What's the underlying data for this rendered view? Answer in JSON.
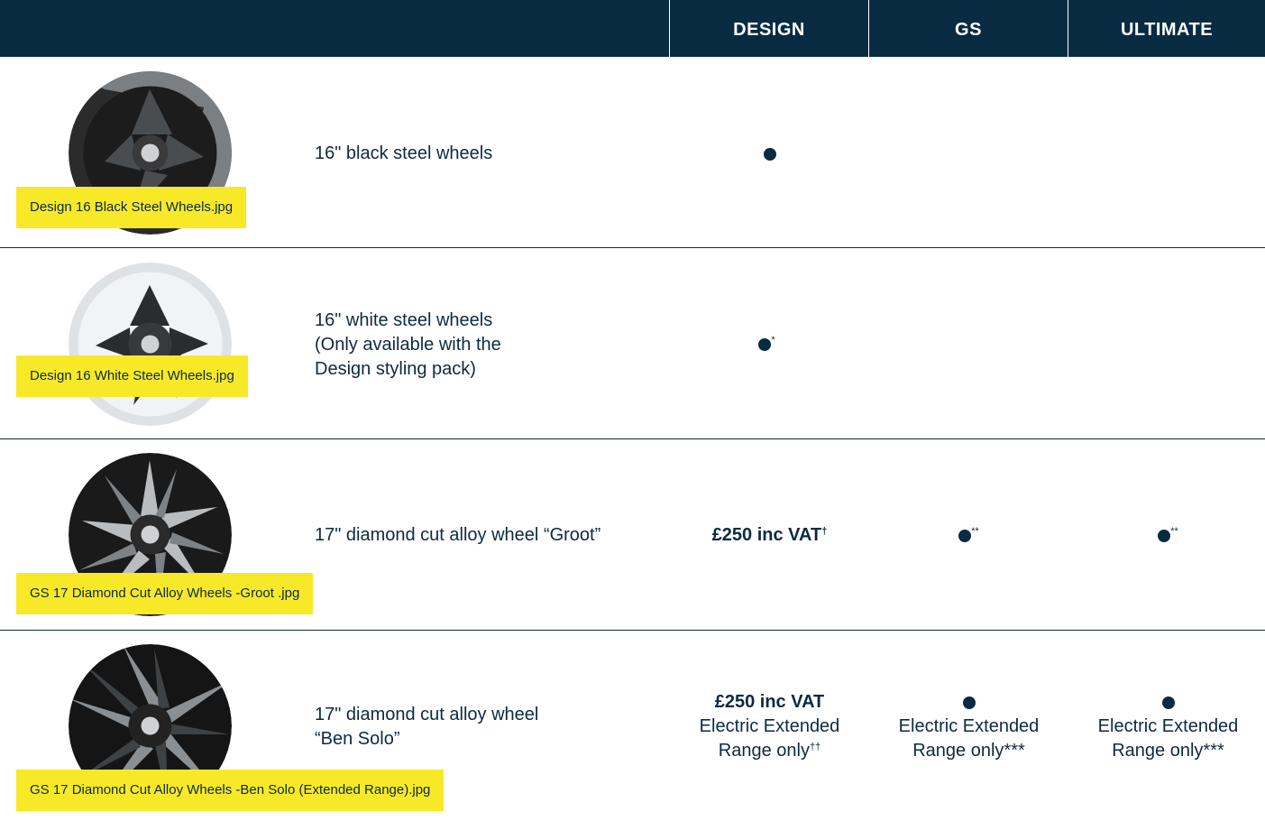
{
  "header": {
    "col_design": "DESIGN",
    "col_gs": "GS",
    "col_ultimate": "ULTIMATE"
  },
  "rows": [
    {
      "image_label": "Design 16 Black Steel Wheels.jpg",
      "description": [
        "16\" black steel wheels"
      ],
      "design": {
        "dot": true,
        "sup": ""
      },
      "gs": null,
      "ultimate": null
    },
    {
      "image_label": "Design 16 White Steel Wheels.jpg",
      "description": [
        "16\" white steel wheels",
        "(Only available with the",
        "Design styling pack)"
      ],
      "design": {
        "dot": true,
        "sup": "*"
      },
      "gs": null,
      "ultimate": null
    },
    {
      "image_label": "GS 17 Diamond Cut  Alloy Wheels -Groot .jpg",
      "description": [
        "17\" diamond cut alloy wheel “Groot”"
      ],
      "design": {
        "price": "£250 inc VAT",
        "sup": "†"
      },
      "gs": {
        "dot": true,
        "sup": "**"
      },
      "ultimate": {
        "dot": true,
        "sup": "**"
      }
    },
    {
      "image_label": "GS 17 Diamond Cut  Alloy Wheels -Ben Solo (Extended Range).jpg",
      "description": [
        "17\" diamond cut alloy wheel",
        "“Ben Solo”"
      ],
      "design": {
        "price": "£250 inc VAT",
        "line1": "Electric Extended",
        "line2": "Range only",
        "sup": "††"
      },
      "gs": {
        "dot": true,
        "line1": "Electric Extended",
        "line2": "Range only",
        "sup": "***"
      },
      "ultimate": {
        "dot": true,
        "line1": "Electric Extended",
        "line2": "Range only",
        "sup": "***"
      }
    }
  ],
  "colors": {
    "navy": "#082b42",
    "text": "#0c2a40",
    "tag_yellow": "#f8e928"
  },
  "icons": {
    "availability": "filled-dot-icon"
  }
}
